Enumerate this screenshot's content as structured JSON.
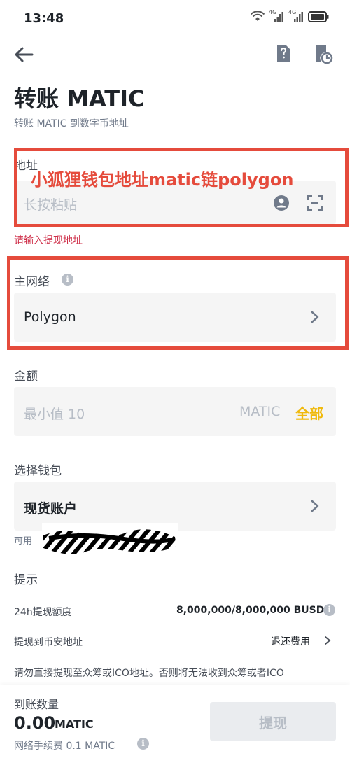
{
  "status_bar": {
    "time": "13:48",
    "network_1": "4G",
    "network_2": "4G"
  },
  "header": {
    "title": "转账 MATIC",
    "subtitle": "转账 MATIC 到数字币地址"
  },
  "address": {
    "label": "地址",
    "placeholder": "长按粘贴",
    "error": "请输入提现地址",
    "annotation": "小狐狸钱包地址matic链polygon"
  },
  "network": {
    "label": "主网络",
    "value": "Polygon"
  },
  "amount": {
    "label": "金额",
    "placeholder": "最小值 10",
    "unit": "MATIC",
    "all_label": "全部"
  },
  "wallet": {
    "label": "选择钱包",
    "value": "现货账户",
    "available_prefix": "可用"
  },
  "tips": {
    "title": "提示",
    "rows": [
      {
        "label": "24h提现额度",
        "value": "8,000,000/8,000,000 BUSD"
      },
      {
        "label": "提现到币安地址",
        "value": "退还费用"
      }
    ],
    "warning": "请勿直接提现至众筹或ICO地址。否则将无法收到众筹或者ICO"
  },
  "footer": {
    "receive_label": "到账数量",
    "receive_amount": "0.00",
    "receive_unit": "MATIC",
    "fee_text": "网络手续费 0.1 MATIC",
    "withdraw_label": "提现"
  },
  "colors": {
    "accent": "#f0b90b",
    "annotation": "#e54b3c",
    "error": "#cf304a"
  }
}
